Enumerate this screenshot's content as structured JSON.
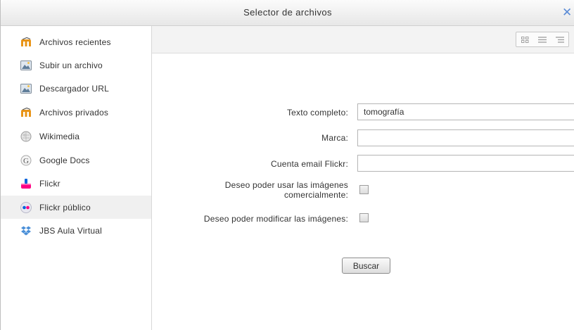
{
  "dialog": {
    "title": "Selector de archivos"
  },
  "sidebar": {
    "items": [
      {
        "label": "Archivos recientes",
        "icon": "moodle-icon"
      },
      {
        "label": "Subir un archivo",
        "icon": "upload-icon"
      },
      {
        "label": "Descargador URL",
        "icon": "url-downloader-icon"
      },
      {
        "label": "Archivos privados",
        "icon": "moodle-icon"
      },
      {
        "label": "Wikimedia",
        "icon": "wikimedia-icon"
      },
      {
        "label": "Google Docs",
        "icon": "google-icon"
      },
      {
        "label": "Flickr",
        "icon": "flickr-icon"
      },
      {
        "label": "Flickr público",
        "icon": "flickr-dots-icon",
        "active": true
      },
      {
        "label": "JBS Aula Virtual",
        "icon": "dropbox-icon"
      }
    ]
  },
  "toolbar": {
    "views": [
      "icon-view-icon",
      "list-view-icon",
      "tree-view-icon"
    ]
  },
  "form": {
    "fulltext_label": "Texto completo:",
    "fulltext_value": "tomografía",
    "tag_label": "Marca:",
    "tag_value": "",
    "email_label": "Cuenta email Flickr:",
    "email_value": "",
    "commercial_label": "Deseo poder usar las imágenes comercialmente:",
    "commercial_checked": false,
    "modify_label": "Deseo poder modificar las imágenes:",
    "modify_checked": false,
    "search_button": "Buscar"
  },
  "colors": {
    "moodle": "#e89417",
    "accent": "#5a8bd6",
    "flickr_pink": "#ff0084",
    "flickr_blue": "#0063dc"
  }
}
